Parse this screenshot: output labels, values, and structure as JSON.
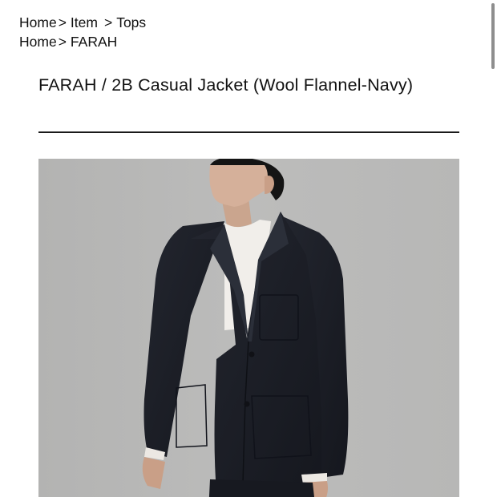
{
  "breadcrumbs": [
    {
      "home": "Home",
      "separators": [
        ">",
        ">"
      ],
      "items": [
        "Item",
        "Tops"
      ]
    },
    {
      "home": "Home",
      "separators": [
        ">"
      ],
      "items": [
        "FARAH"
      ]
    }
  ],
  "product": {
    "title": "FARAH / 2B Casual Jacket (Wool Flannel-Navy)",
    "image": {
      "description": "product-photo",
      "background_color": "#b9b9b8",
      "garment_color": "#1b1e27"
    }
  }
}
